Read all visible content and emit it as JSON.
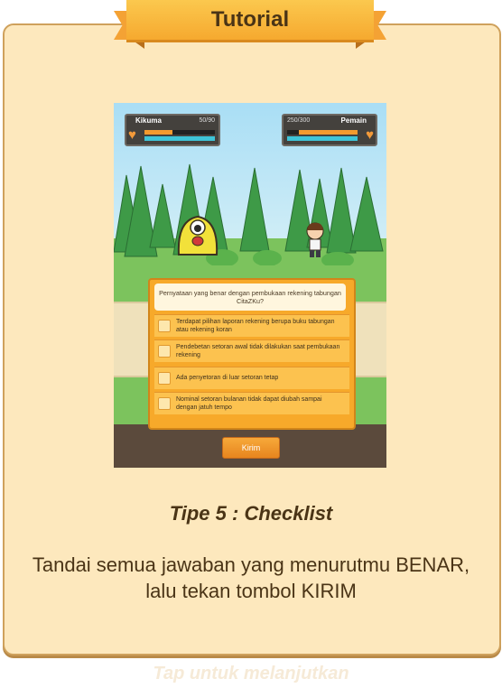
{
  "header": {
    "title": "Tutorial"
  },
  "game": {
    "enemy_name": "Kikuma",
    "enemy_hp": "50/90",
    "player_hp": "250/300",
    "player_name": "Pemain",
    "question": "Pernyataan yang benar dengan pembukaan rekening tabungan CitaZKu?",
    "options": [
      "Terdapat pilihan laporan rekening berupa buku tabungan atau rekening koran",
      "Pendebetan setoran awal tidak dilakukan saat pembukaan rekening",
      "Ada penyetoran di luar setoran tetap",
      "Nominal setoran bulanan tidak dapat diubah sampai dengan jatuh tempo"
    ],
    "submit_label": "Kirim"
  },
  "caption": {
    "title": "Tipe 5 : Checklist",
    "body": "Tandai semua jawaban yang menurutmu BENAR, lalu tekan tombol KIRIM"
  },
  "footer": {
    "tap_hint": "Tap untuk melanjutkan"
  },
  "colors": {
    "panel": "#fde8bd",
    "ribbon": "#f6a92f",
    "text": "#4a3416",
    "button": "#e7851e"
  }
}
